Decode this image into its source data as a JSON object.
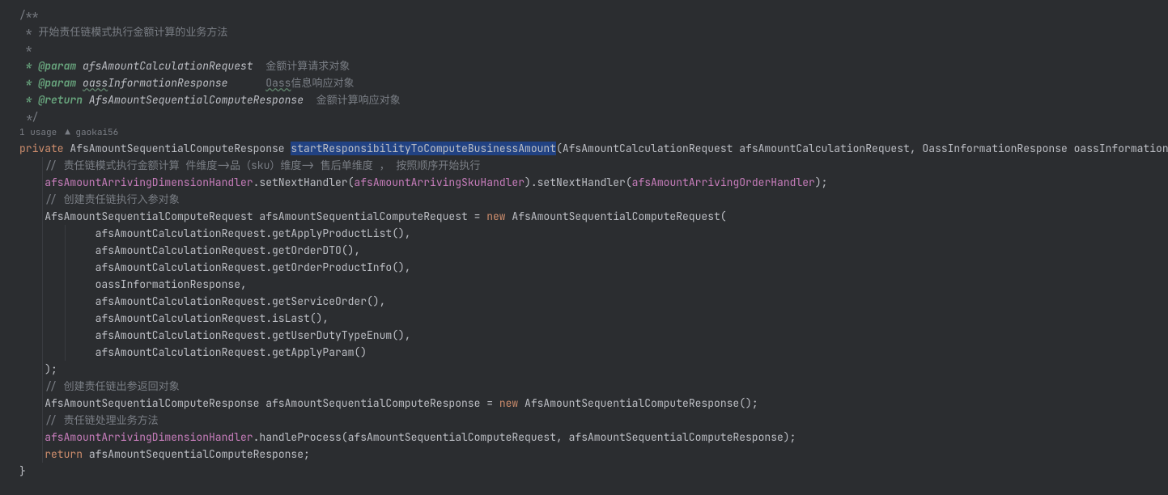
{
  "doc": {
    "open": "/**",
    "line1": " * 开始责任链模式执行金额计算的业务方法",
    "blank": " *",
    "param1_tag": " * @param",
    "param1_name": " afsAmountCalculationRequest",
    "param1_desc": "  金额计算请求对象",
    "param2_tag": " * @param",
    "param2_name": " oassInformationResponse",
    "param2_name_prefix": " ",
    "param2_name_u": "oass",
    "param2_name_rest": "InformationResponse",
    "param2_spacer": "      ",
    "param2_desc_u": "Oass",
    "param2_desc_rest": "信息响应对象",
    "return_tag": " * @return",
    "return_type": " AfsAmountSequentialComputeResponse",
    "return_desc": "  金额计算响应对象",
    "close": " */"
  },
  "meta": {
    "usage": "1 usage",
    "author": "gaokai56"
  },
  "sig": {
    "modifier": "private",
    "return_type": " AfsAmountSequentialComputeResponse ",
    "method_name": "startResponsibilityToComputeBusinessAmount",
    "params": "(AfsAmountCalculationRequest afsAmountCalculationRequest, OassInformationResponse oassInformationResponse) {",
    "cursor_after": "  "
  },
  "body": {
    "c1": "    // 责任链模式执行金额计算 件维度->品（sku）维度-> 售后单维度 ， 按照顺序开始执行",
    "l1_field1": "afsAmountArrivingDimensionHandler",
    "l1_m1": ".setNextHandler(",
    "l1_field2": "afsAmountArrivingSkuHandler",
    "l1_m2": ").setNextHandler(",
    "l1_field3": "afsAmountArrivingOrderHandler",
    "l1_end": ");",
    "c2": "    // 创建责任链执行入参对象",
    "l2_decl": "    AfsAmountSequentialComputeRequest afsAmountSequentialComputeRequest = ",
    "l2_new": "new",
    "l2_ctor": " AfsAmountSequentialComputeRequest(",
    "arg1": "            afsAmountCalculationRequest.getApplyProductList(),",
    "arg2": "            afsAmountCalculationRequest.getOrderDTO(),",
    "arg3": "            afsAmountCalculationRequest.getOrderProductInfo(),",
    "arg4": "            oassInformationResponse,",
    "arg5": "            afsAmountCalculationRequest.getServiceOrder(),",
    "arg6": "            afsAmountCalculationRequest.isLast(),",
    "arg7": "            afsAmountCalculationRequest.getUserDutyTypeEnum(),",
    "arg8": "            afsAmountCalculationRequest.getApplyParam()",
    "close_paren": "    );",
    "c3": "    // 创建责任链出参返回对象",
    "l3_decl": "    AfsAmountSequentialComputeResponse afsAmountSequentialComputeResponse = ",
    "l3_new": "new",
    "l3_ctor": " AfsAmountSequentialComputeResponse();",
    "c4": "    // 责任链处理业务方法",
    "l4_field": "afsAmountArrivingDimensionHandler",
    "l4_call": ".handleProcess(afsAmountSequentialComputeRequest, afsAmountSequentialComputeResponse);",
    "ret_kw": "return",
    "ret_val": " afsAmountSequentialComputeResponse;",
    "brace": "}"
  }
}
